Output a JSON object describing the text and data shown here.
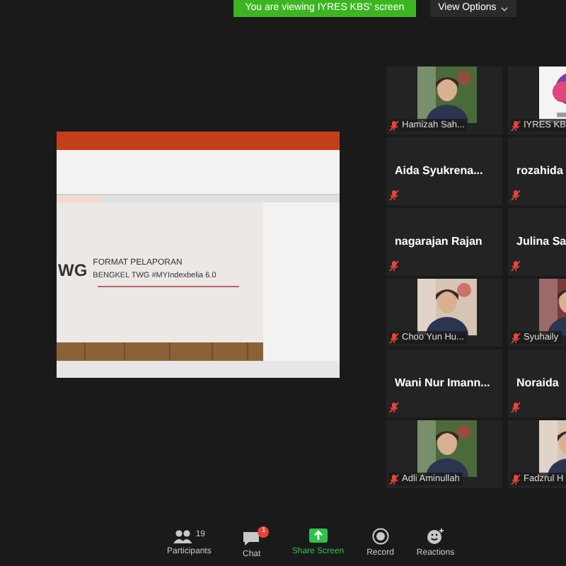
{
  "banner": {
    "text": "You are viewing IYRES KBS' screen"
  },
  "view_options": {
    "label": "View Options"
  },
  "shared_window": {
    "slide": {
      "logo": "WG",
      "title": "FORMAT PELAPORAN",
      "subtitle": "BENGKEL TWG #MYIndexbelia 6.0"
    }
  },
  "tiles": [
    {
      "name": "Hamizah Sah...",
      "kind": "video",
      "muted": true
    },
    {
      "name": "IYRES KB",
      "kind": "logo",
      "muted": true
    },
    {
      "name": "Aida  Syukrena...",
      "kind": "name",
      "muted": true
    },
    {
      "name": "rozahida",
      "kind": "name",
      "muted": true
    },
    {
      "name": "nagarajan Rajan",
      "kind": "name",
      "muted": true
    },
    {
      "name": "Julina Sa",
      "kind": "name",
      "muted": true
    },
    {
      "name": "Choo Yun Hu...",
      "kind": "video",
      "muted": true
    },
    {
      "name": "Syuhaily",
      "kind": "video",
      "muted": true
    },
    {
      "name": "Wani  Nur  Imann...",
      "kind": "name",
      "muted": true
    },
    {
      "name": "Noraida",
      "kind": "name",
      "muted": true
    },
    {
      "name": "Adli Aminullah",
      "kind": "video",
      "muted": true
    },
    {
      "name": "Fadzrul H",
      "kind": "video",
      "muted": true
    }
  ],
  "toolbar": [
    {
      "label": "Participants",
      "kind": "participants",
      "count": "19"
    },
    {
      "label": "Chat",
      "kind": "chat",
      "badge": "1"
    },
    {
      "label": "Share Screen",
      "kind": "share"
    },
    {
      "label": "Record",
      "kind": "record"
    },
    {
      "label": "Reactions",
      "kind": "reactions"
    }
  ]
}
